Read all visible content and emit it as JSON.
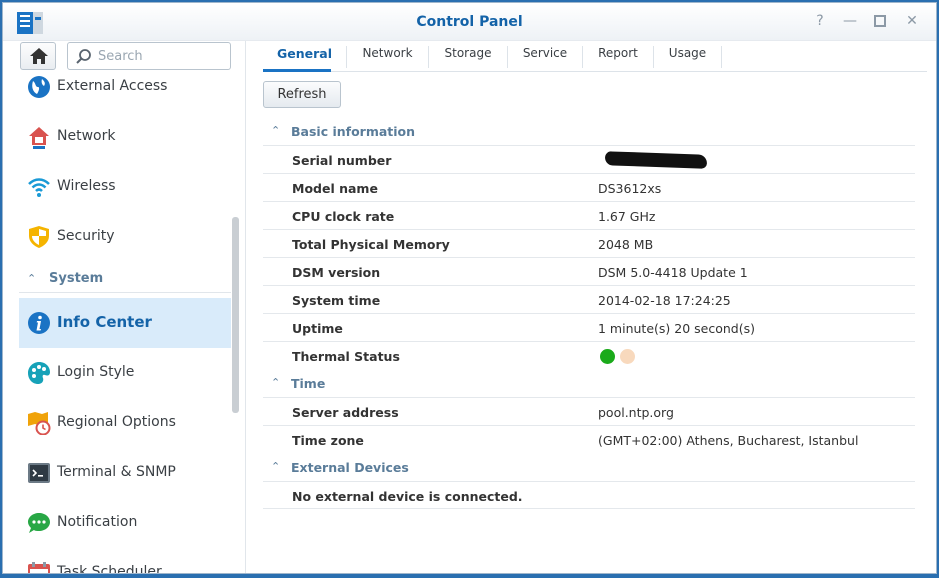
{
  "window": {
    "title": "Control Panel"
  },
  "sidebar": {
    "search_placeholder": "Search",
    "items": [
      {
        "label": "External Access",
        "icon": "globe-icon"
      },
      {
        "label": "Network",
        "icon": "house-network-icon"
      },
      {
        "label": "Wireless",
        "icon": "wifi-icon"
      },
      {
        "label": "Security",
        "icon": "shield-icon"
      }
    ],
    "section": "System",
    "system_items": [
      {
        "label": "Info Center",
        "icon": "info-icon",
        "active": true
      },
      {
        "label": "Login Style",
        "icon": "palette-icon"
      },
      {
        "label": "Regional Options",
        "icon": "map-clock-icon"
      },
      {
        "label": "Terminal & SNMP",
        "icon": "terminal-icon"
      },
      {
        "label": "Notification",
        "icon": "chat-bubble-icon"
      },
      {
        "label": "Task Scheduler",
        "icon": "calendar-icon"
      }
    ]
  },
  "tabs": [
    "General",
    "Network",
    "Storage",
    "Service",
    "Report",
    "Usage"
  ],
  "refresh_label": "Refresh",
  "basic": {
    "header": "Basic information",
    "rows": [
      {
        "k": "Serial number",
        "v": ""
      },
      {
        "k": "Model name",
        "v": "DS3612xs"
      },
      {
        "k": "CPU clock rate",
        "v": "1.67 GHz"
      },
      {
        "k": "Total Physical Memory",
        "v": "2048 MB"
      },
      {
        "k": "DSM version",
        "v": "DSM 5.0-4418 Update 1"
      },
      {
        "k": "System time",
        "v": "2014-02-18 17:24:25"
      },
      {
        "k": "Uptime",
        "v": "1 minute(s) 20 second(s)"
      },
      {
        "k": "Thermal Status",
        "v": ""
      }
    ],
    "thermal_colors": {
      "good": "#1aaa1a",
      "warn": "#f8d9bd"
    }
  },
  "time": {
    "header": "Time",
    "rows": [
      {
        "k": "Server address",
        "v": "pool.ntp.org"
      },
      {
        "k": "Time zone",
        "v": "(GMT+02:00) Athens, Bucharest, Istanbul"
      }
    ]
  },
  "external": {
    "header": "External Devices",
    "message": "No external device is connected."
  },
  "colors": {
    "accent": "#1463a8",
    "active_bg": "#d9ebfa",
    "section": "#5a7c99"
  }
}
